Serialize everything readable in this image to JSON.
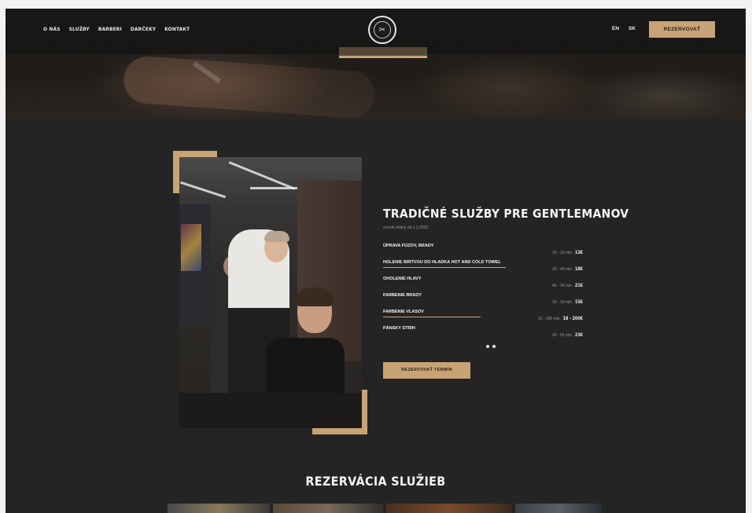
{
  "nav": {
    "links": [
      "O NÁS",
      "SLUŽBY",
      "BARBERI",
      "DARČEKY",
      "KONTAKT"
    ],
    "languages": [
      "EN",
      "SK"
    ],
    "cta_label": "REZERVOVAŤ"
  },
  "services": {
    "title": "TRADIČNÉ SLUŽBY PRE GENTLEMANOV",
    "subtitle": "cenník platný od 1.2.2022",
    "items": [
      {
        "name": "ÚPRAVA FÚZOV, BRADY",
        "duration": "15 - 30 min",
        "price": "13€"
      },
      {
        "name": "HOLENIE BRITVOU DO HLADKA HOT AND COLD TOWEL",
        "duration": "30 - 45 min",
        "price": "18€"
      },
      {
        "name": "OHOLENIE HLAVY",
        "duration": "45 - 30 min",
        "price": "21€"
      },
      {
        "name": "FARBENIE BRADY",
        "duration": "15 - 20 min",
        "price": "15€"
      },
      {
        "name": "FARBENIE VLASOV",
        "duration": "15 - 200 min",
        "price": "18 - 200€"
      },
      {
        "name": "PÁNSKY STRIH",
        "duration": "30 - 60 min",
        "price": "23€"
      }
    ],
    "button_label": "REZERVOVAŤ TERMÍN"
  },
  "booking": {
    "title": "REZERVÁCIA SLUŽIEB"
  },
  "colors": {
    "accent": "#c8a376",
    "background": "#242424",
    "text": "#f3f3f3"
  }
}
